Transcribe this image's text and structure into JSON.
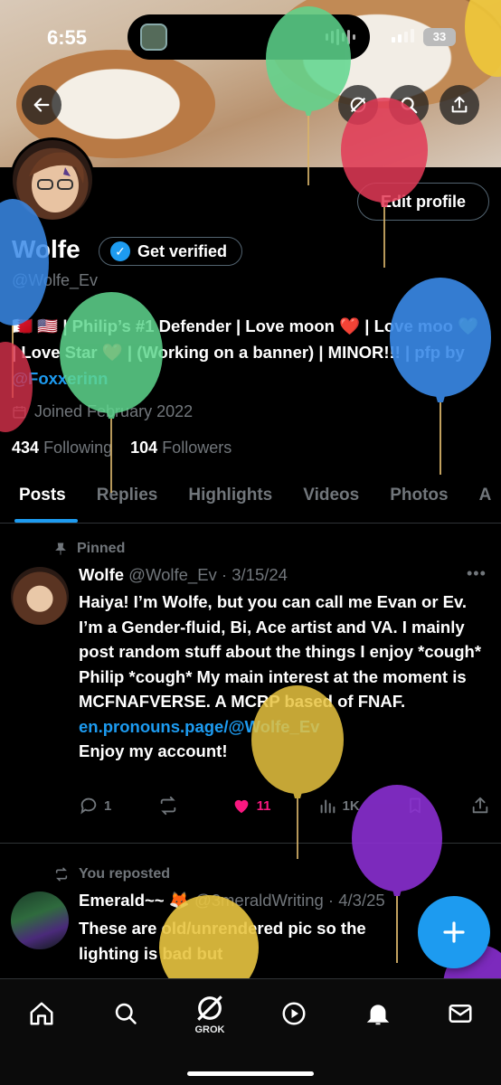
{
  "status_bar": {
    "time": "6:55",
    "battery": "33"
  },
  "header": {
    "back_label": "Back",
    "grok_label": "Grok",
    "search_label": "Search",
    "share_label": "Share"
  },
  "profile": {
    "display_name": "Wolfe",
    "verify_label": "Get verified",
    "handle": "@Wolfe_Ev",
    "edit_label": "Edit profile",
    "bio_flags": "🇧🇭 🇺🇸",
    "bio_text": " | Philip’s #1 Defender | Love moon ❤️ | Love moo 💚 | Love Star ❤️ | (Working on a banner) | MINOR!!! | pfp by ",
    "bio_link": "@Foxxerinn",
    "joined": "Joined February 2022",
    "following_count": "434",
    "following_label": "Following",
    "followers_count": "104",
    "followers_label": "Followers"
  },
  "tabs": [
    "Posts",
    "Replies",
    "Highlights",
    "Videos",
    "Photos",
    "A"
  ],
  "posts": [
    {
      "context": "Pinned",
      "name": "Wolfe",
      "meta": "@Wolfe_Ev · 3/15/24",
      "text": "Haiya! I’m Wolfe, but you can call me Evan or Ev. I’m a Gender-fluid, Bi, Ace artist and VA. I mainly post random stuff about the things I enjoy *cough* Philip *cough* My main interest at the moment is MCFNAFVERSE. A MCRP based of FNAF.",
      "link": "en.pronouns.page/@Wolfe_Ev",
      "text2": "Enjoy my account!",
      "replies": "1",
      "reposts": "",
      "likes": "11",
      "views": "1K"
    },
    {
      "context": "You reposted",
      "name": "Emerald~~ 🦊",
      "meta": "@3meraldWriting · 4/3/25",
      "text": "These are old/unrendered pic so the lighting is bad but"
    }
  ],
  "nav": {
    "grok_label": "GROK"
  },
  "colors": {
    "accent": "#1d9bf0",
    "like": "#f91880",
    "muted": "#71767b",
    "border": "#2f3336"
  }
}
